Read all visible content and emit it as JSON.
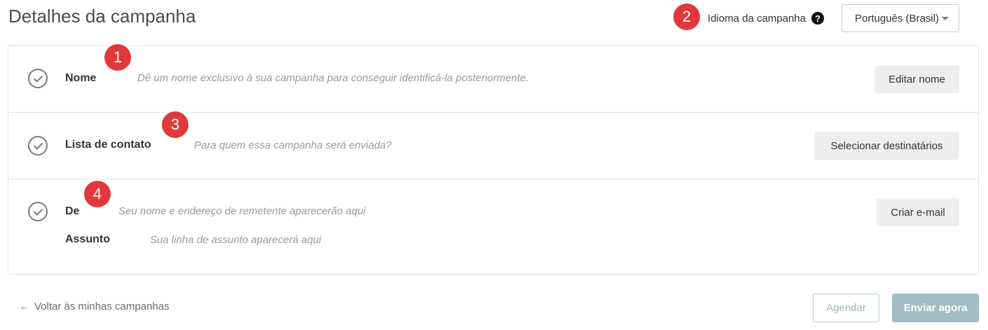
{
  "header": {
    "title": "Detalhes da campanha",
    "language_label": "Idioma da campanha",
    "help_symbol": "?",
    "language_value": "Português (Brasil)"
  },
  "rows": [
    {
      "label": "Nome",
      "hint": "Dê um nome exclusivo à sua campanha para conseguir identificá-la posteriormente.",
      "button": "Editar nome"
    },
    {
      "label": "Lista de contato",
      "hint": "Para quem essa campanha será enviada?",
      "button": "Selecionar destinatários"
    },
    {
      "label": "De",
      "hint": "Seu nome e endereço de remetente aparecerão aqui",
      "button": "Criar e-mail",
      "sub_label": "Assunto",
      "sub_hint": "Sua linha de assunto aparecerá aqui"
    }
  ],
  "badges": [
    "1",
    "2",
    "3",
    "4"
  ],
  "footer": {
    "back_arrow": "←",
    "back_label": "Voltar às minhas campanhas",
    "schedule_label": "Agendar",
    "send_label": "Enviar agora"
  },
  "colors": {
    "badge": "#e0383b",
    "primary_disabled": "#a3bcc5",
    "outline_disabled": "#a9cfd6"
  },
  "icons": [
    "check-circle-icon",
    "help-icon",
    "chevron-down-icon",
    "arrow-left-icon"
  ]
}
